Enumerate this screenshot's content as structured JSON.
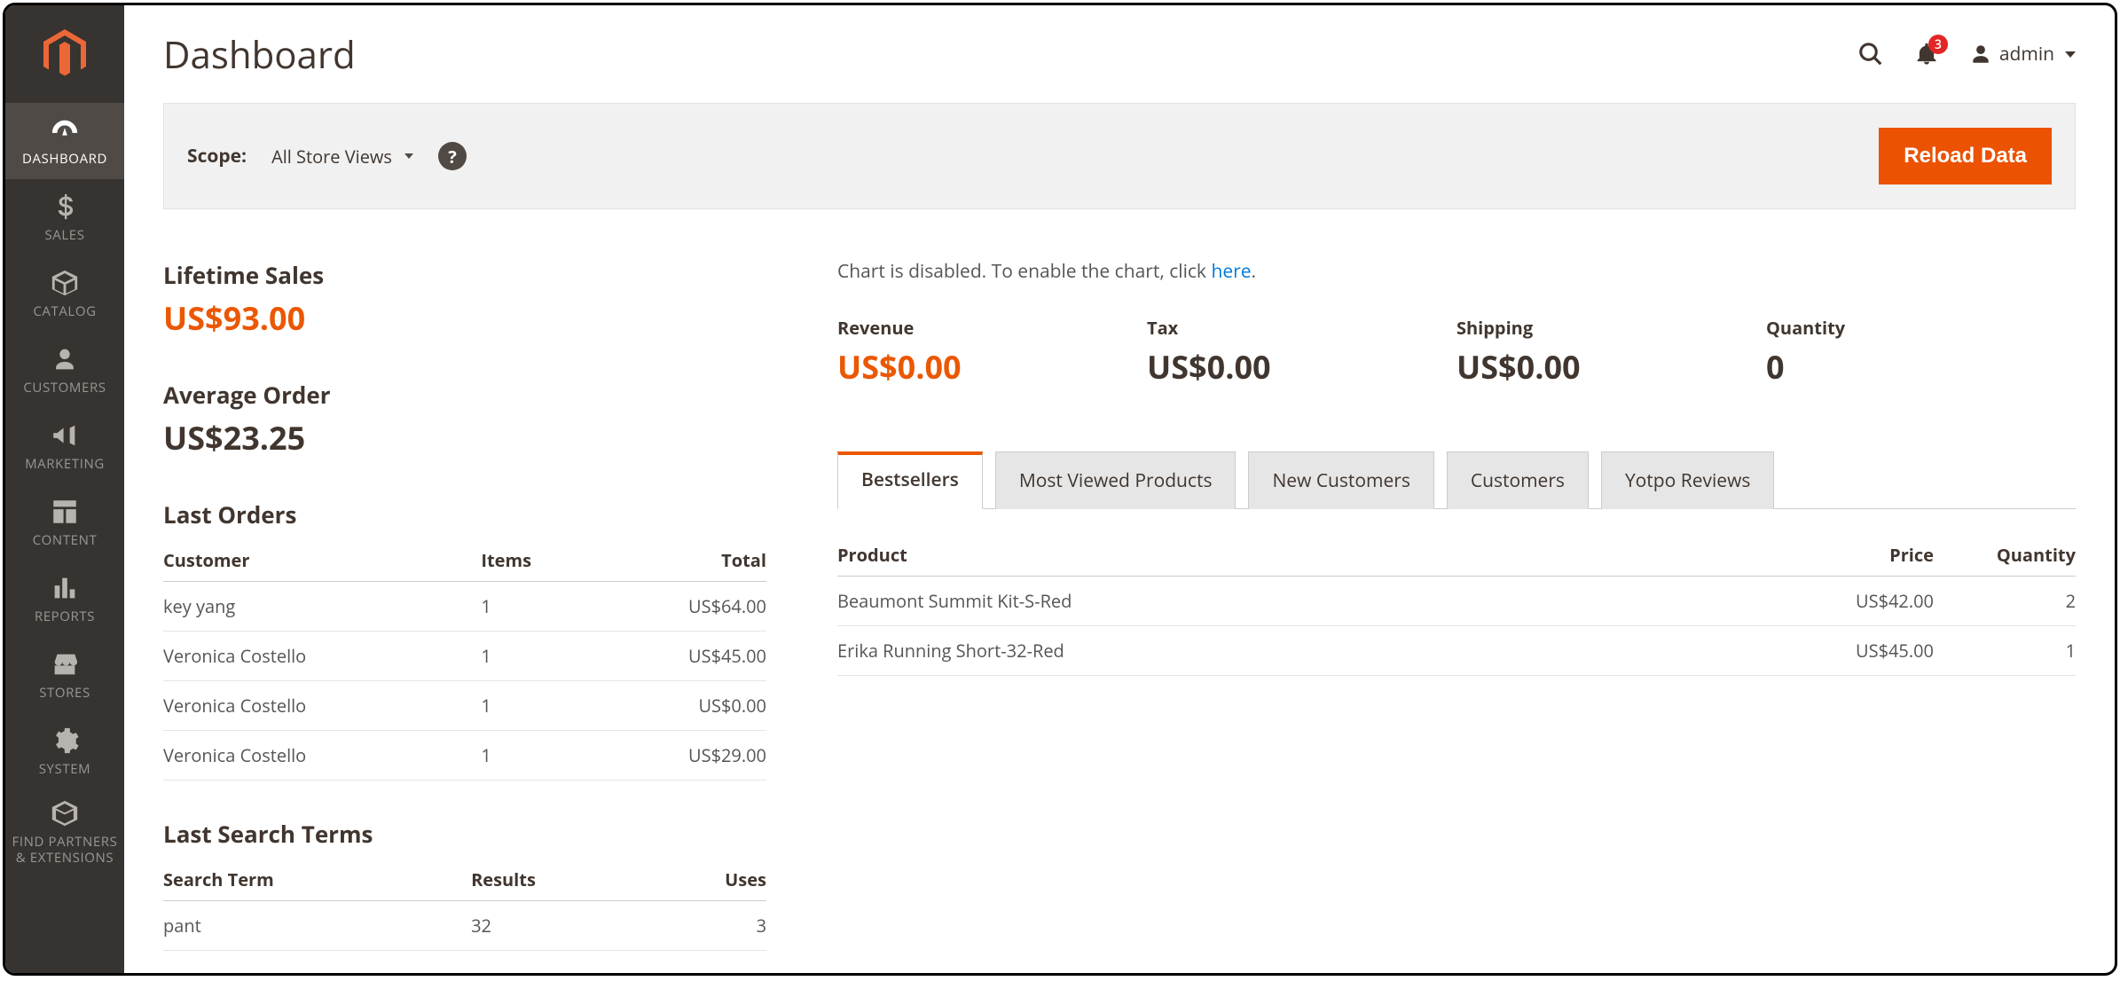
{
  "sidebar": {
    "items": [
      {
        "label": "DASHBOARD"
      },
      {
        "label": "SALES"
      },
      {
        "label": "CATALOG"
      },
      {
        "label": "CUSTOMERS"
      },
      {
        "label": "MARKETING"
      },
      {
        "label": "CONTENT"
      },
      {
        "label": "REPORTS"
      },
      {
        "label": "STORES"
      },
      {
        "label": "SYSTEM"
      },
      {
        "label": "FIND PARTNERS & EXTENSIONS"
      }
    ]
  },
  "header": {
    "title": "Dashboard",
    "notif_count": "3",
    "user": "admin"
  },
  "scope": {
    "label": "Scope:",
    "value": "All Store Views",
    "help": "?",
    "reload": "Reload Data"
  },
  "lifetime": {
    "title": "Lifetime Sales",
    "value": "US$93.00"
  },
  "average": {
    "title": "Average Order",
    "value": "US$23.25"
  },
  "last_orders": {
    "title": "Last Orders",
    "cols": {
      "customer": "Customer",
      "items": "Items",
      "total": "Total"
    },
    "rows": [
      {
        "customer": "key yang",
        "items": "1",
        "total": "US$64.00"
      },
      {
        "customer": "Veronica Costello",
        "items": "1",
        "total": "US$45.00"
      },
      {
        "customer": "Veronica Costello",
        "items": "1",
        "total": "US$0.00"
      },
      {
        "customer": "Veronica Costello",
        "items": "1",
        "total": "US$29.00"
      }
    ]
  },
  "last_search": {
    "title": "Last Search Terms",
    "cols": {
      "term": "Search Term",
      "results": "Results",
      "uses": "Uses"
    },
    "rows": [
      {
        "term": "pant",
        "results": "32",
        "uses": "3"
      }
    ]
  },
  "chart_msg": {
    "prefix": "Chart is disabled. To enable the chart, click ",
    "link": "here",
    "suffix": "."
  },
  "stats": {
    "revenue": {
      "label": "Revenue",
      "value": "US$0.00"
    },
    "tax": {
      "label": "Tax",
      "value": "US$0.00"
    },
    "shipping": {
      "label": "Shipping",
      "value": "US$0.00"
    },
    "quantity": {
      "label": "Quantity",
      "value": "0"
    }
  },
  "tabs": {
    "bestsellers": "Bestsellers",
    "most_viewed": "Most Viewed Products",
    "new_customers": "New Customers",
    "customers": "Customers",
    "yotpo": "Yotpo Reviews"
  },
  "bestsellers": {
    "cols": {
      "product": "Product",
      "price": "Price",
      "qty": "Quantity"
    },
    "rows": [
      {
        "product": "Beaumont Summit Kit-S-Red",
        "price": "US$42.00",
        "qty": "2"
      },
      {
        "product": "Erika Running Short-32-Red",
        "price": "US$45.00",
        "qty": "1"
      }
    ]
  }
}
